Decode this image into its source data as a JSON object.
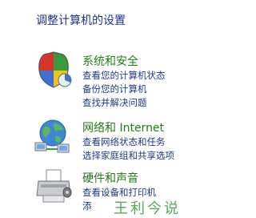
{
  "page": {
    "title": "调整计算机的设置"
  },
  "categories": [
    {
      "title": "系统和安全",
      "icon": "shield-icon",
      "links": [
        "查看您的计算机状态",
        "备份您的计算机",
        "查找并解决问题"
      ]
    },
    {
      "title": "网络和 Internet",
      "icon": "network-globe-icon",
      "links": [
        "查看网络状态和任务",
        "选择家庭组和共享选项"
      ]
    },
    {
      "title": "硬件和声音",
      "icon": "printer-icon",
      "links": [
        "查看设备和打印机",
        "添"
      ]
    }
  ],
  "watermark": {
    "text": "王利今说"
  },
  "colors": {
    "title": "#1e3287",
    "category_title": "#1f7d14",
    "link": "#1e3a8a"
  }
}
